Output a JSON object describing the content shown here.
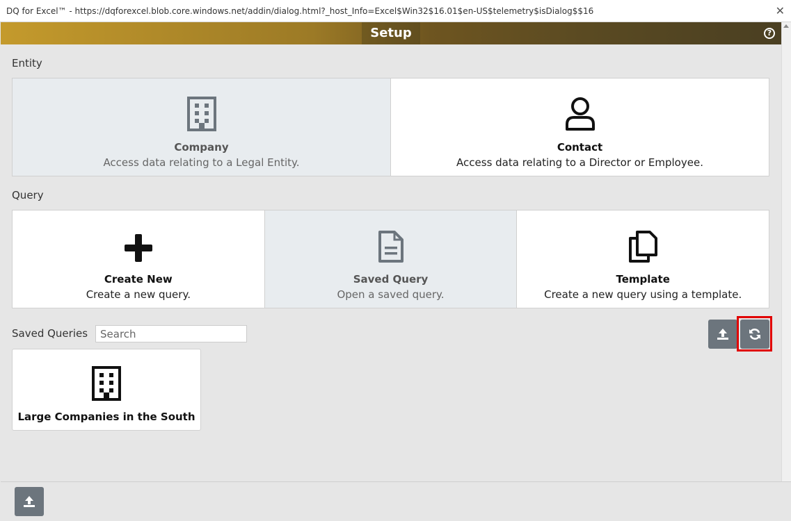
{
  "window": {
    "title": "DQ for Excel™ - https://dqforexcel.blob.core.windows.net/addin/dialog.html?_host_Info=Excel$Win32$16.01$en-US$telemetry$isDialog$$16",
    "close_glyph": "✕"
  },
  "header": {
    "title": "Setup",
    "help_glyph": "?"
  },
  "entity": {
    "label": "Entity",
    "cards": [
      {
        "name": "Company",
        "desc": "Access data relating to a Legal Entity.",
        "icon": "building-icon",
        "selected": true
      },
      {
        "name": "Contact",
        "desc": "Access data relating to a Director or Employee.",
        "icon": "user-icon",
        "selected": false
      }
    ]
  },
  "query": {
    "label": "Query",
    "cards": [
      {
        "name": "Create New",
        "desc": "Create a new query.",
        "icon": "plus-icon",
        "selected": false
      },
      {
        "name": "Saved Query",
        "desc": "Open a saved query.",
        "icon": "file-icon",
        "selected": true
      },
      {
        "name": "Template",
        "desc": "Create a new query using a template.",
        "icon": "copy-icon",
        "selected": false
      }
    ]
  },
  "saved_queries": {
    "label": "Saved Queries",
    "search_placeholder": "Search",
    "items": [
      {
        "name": "Large Companies in the South",
        "icon": "building-icon"
      }
    ]
  },
  "colors": {
    "header_start": "#c49a2c",
    "header_end": "#4a3f22",
    "button": "#6c757d",
    "highlight": "#e00000",
    "selected_card": "#e8ecef"
  }
}
